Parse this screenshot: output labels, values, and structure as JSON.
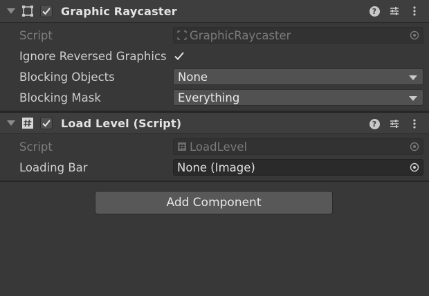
{
  "components": [
    {
      "title": "Graphic Raycaster",
      "icon": "rect-transform-icon",
      "enabled": true,
      "properties": {
        "script": {
          "label": "Script",
          "value": "GraphicRaycaster"
        },
        "ignore_reversed": {
          "label": "Ignore Reversed Graphics",
          "checked": true
        },
        "blocking_objects": {
          "label": "Blocking Objects",
          "value": "None"
        },
        "blocking_mask": {
          "label": "Blocking Mask",
          "value": "Everything"
        }
      }
    },
    {
      "title": "Load Level (Script)",
      "icon": "csharp-script-icon",
      "enabled": true,
      "properties": {
        "script": {
          "label": "Script",
          "value": "LoadLevel"
        },
        "loading_bar": {
          "label": "Loading Bar",
          "value": "None (Image)"
        }
      }
    }
  ],
  "header_tools": {
    "help": "?"
  },
  "add_component": {
    "label": "Add Component"
  },
  "colors": {
    "background": "#383838",
    "header": "#3e3e3e",
    "field": "#2a2a2a",
    "button": "#585858"
  }
}
